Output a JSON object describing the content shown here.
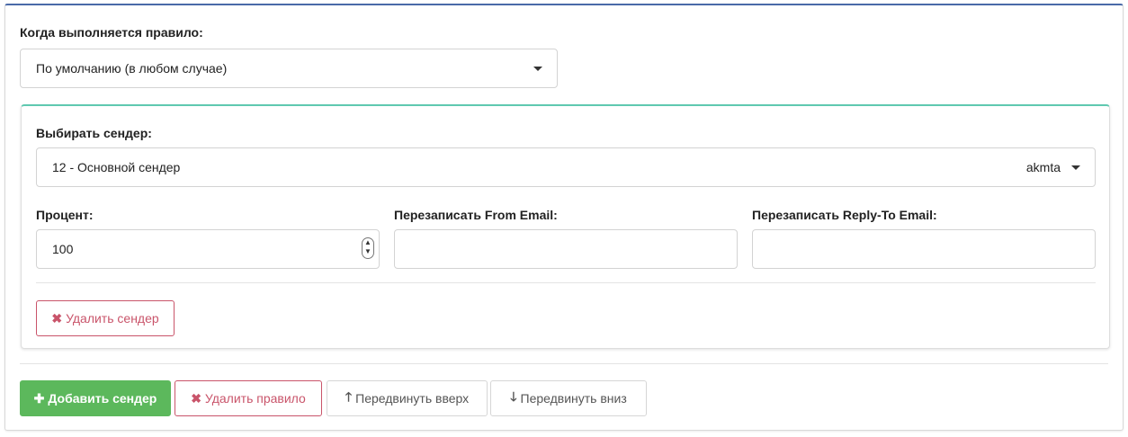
{
  "rule": {
    "when_label": "Когда выполняется правило:",
    "when_value": "По умолчанию (в любом случае)"
  },
  "sender": {
    "select_label": "Выбирать сендер:",
    "select_value": "12 - Основной сендер",
    "select_tag": "akmta",
    "percent_label": "Процент:",
    "percent_value": "100",
    "from_label": "Перезаписать From Email:",
    "from_value": "",
    "reply_label": "Перезаписать Reply-To Email:",
    "reply_value": "",
    "delete_label": "Удалить сендер"
  },
  "actions": {
    "add_sender": "Добавить сендер",
    "delete_rule": "Удалить правило",
    "move_up": "Передвинуть вверх",
    "move_down": "Передвинуть вниз"
  },
  "icons": {
    "times": "✖",
    "plus": "✚",
    "arrow_up": "🡑",
    "arrow_down": "🡓"
  },
  "colors": {
    "top_border": "#4a6aa8",
    "inner_border": "#5fc9b0",
    "danger": "#c9546a",
    "success": "#5cb85c"
  }
}
